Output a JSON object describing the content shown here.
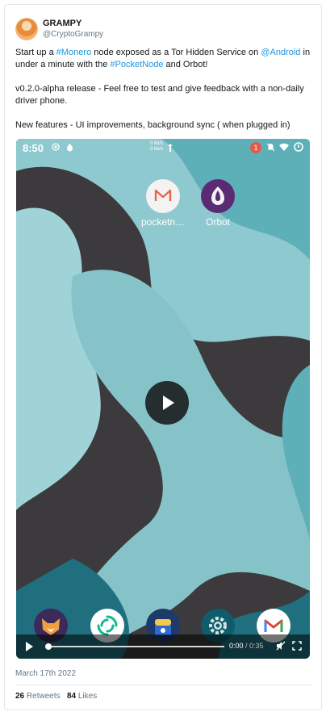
{
  "author": {
    "name": "GRAMPY",
    "handle": "@CryptoGrampy"
  },
  "tweet": {
    "line1_a": "Start up a ",
    "line1_tag_monero": "#Monero",
    "line1_b": " node exposed as a Tor Hidden Service on ",
    "line1_mention_android": "@Android",
    "line1_c": " in under a minute with the ",
    "line1_tag_pocketnode": "#PocketNode",
    "line1_d": " and Orbot!",
    "line2": "v0.2.0-alpha release - Feel free to test and give feedback with a non-daily driver phone.",
    "line3": "New features - UI improvements, background sync ( when plugged in)"
  },
  "phone": {
    "clock": "8:50",
    "net_up": "0 kb/s",
    "net_down": "0 kb/s",
    "notification_count": "1",
    "apps": [
      {
        "label": "pocketn…",
        "icon": "pocketnode-icon"
      },
      {
        "label": "Orbot",
        "icon": "orbot-icon"
      }
    ],
    "dock": [
      "fox-icon",
      "element-icon",
      "android-app-icon",
      "settings-icon",
      "gmail-icon"
    ]
  },
  "video": {
    "current_time": "0:00",
    "separator": " / ",
    "duration": "0:35",
    "progress": 0.0
  },
  "date": "March 17th 2022",
  "stats": {
    "retweets_count": "26",
    "retweets_label": "Retweets",
    "likes_count": "84",
    "likes_label": "Likes"
  },
  "colors": {
    "link": "#1b95e0",
    "wallpaper_light": "#8ec9cf",
    "wallpaper_mid": "#5eb0b8",
    "wallpaper_dark": "#3c3a3d",
    "wallpaper_deep": "#1f6f7e"
  }
}
